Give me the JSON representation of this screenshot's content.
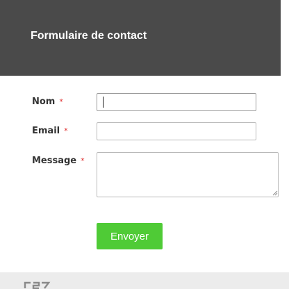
{
  "header": {
    "title": "Formulaire de contact",
    "background": "#4a4a4a"
  },
  "form": {
    "required_marker": "*",
    "fields": [
      {
        "label": "Nom",
        "value": "",
        "required": true
      },
      {
        "label": "Email",
        "value": "",
        "required": true
      },
      {
        "label": "Message",
        "value": "",
        "required": true
      }
    ],
    "submit_label": "Envoyer",
    "submit_color": "#4fcb36",
    "required_color": "#e03030"
  },
  "footer": {
    "logo_icon": "brand-logo-icon"
  }
}
